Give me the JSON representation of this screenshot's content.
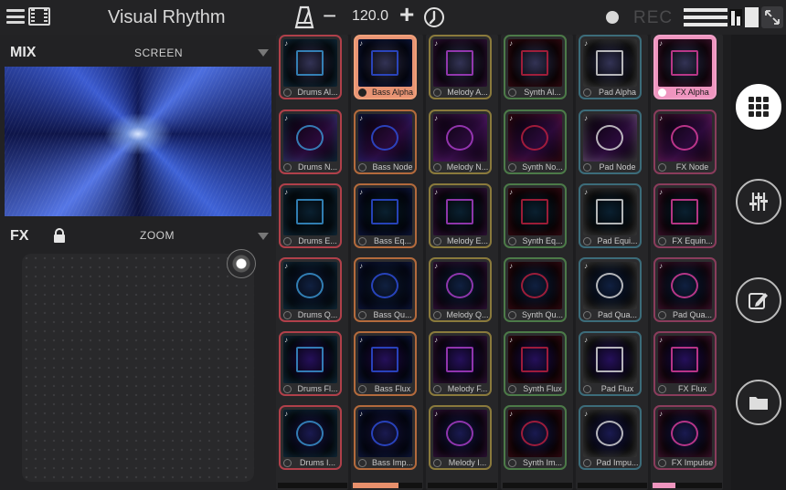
{
  "topbar": {
    "title": "Visual Rhythm",
    "tempo": "120.0",
    "minus_label": "−",
    "plus_label": "+",
    "rec_label": "REC"
  },
  "mix": {
    "label": "MIX",
    "mode": "SCREEN"
  },
  "fx": {
    "label": "FX",
    "mode": "ZOOM"
  },
  "grid": {
    "columns": [
      {
        "accent": "#b0404a",
        "bar_fill": 0.0,
        "pads": [
          "Drums Al...",
          "Drums N...",
          "Drums E...",
          "Drums Q...",
          "Drums Fl...",
          "Drums I..."
        ]
      },
      {
        "accent": "#b36a3c",
        "bar_fill": 0.66,
        "bar_color": "#e8906c",
        "pads": [
          "Bass Alpha",
          "Bass Node",
          "Bass Eq...",
          "Bass Qu...",
          "Bass Flux",
          "Bass Imp..."
        ]
      },
      {
        "accent": "#8a7a3c",
        "bar_fill": 0.0,
        "pads": [
          "Melody A...",
          "Melody N...",
          "Melody E...",
          "Melody Q...",
          "Melody F...",
          "Melody I..."
        ]
      },
      {
        "accent": "#4c7a48",
        "bar_fill": 0.0,
        "pads": [
          "Synth Al...",
          "Synth No...",
          "Synth Eq...",
          "Synth Qu...",
          "Synth Flux",
          "Synth Im..."
        ]
      },
      {
        "accent": "#3c6c7a",
        "bar_fill": 0.0,
        "pads": [
          "Pad Alpha",
          "Pad Node",
          "Pad Equi...",
          "Pad Qua...",
          "Pad Flux",
          "Pad Impu..."
        ]
      },
      {
        "accent": "#8a3c5c",
        "bar_fill": 0.33,
        "bar_color": "#ef95bf",
        "pads": [
          "FX Alpha",
          "FX Node",
          "FX Equin...",
          "Pad Qua...",
          "FX Flux",
          "FX Impulse"
        ]
      }
    ],
    "active": [
      {
        "col": 1,
        "row": 0
      },
      {
        "col": 5,
        "row": 0
      }
    ]
  },
  "rail": {
    "buttons": [
      {
        "name": "grid-view-icon",
        "selected": true
      },
      {
        "name": "mixer-sliders-icon",
        "selected": false
      },
      {
        "name": "edit-icon",
        "selected": false
      },
      {
        "name": "folder-icon",
        "selected": false
      }
    ]
  }
}
